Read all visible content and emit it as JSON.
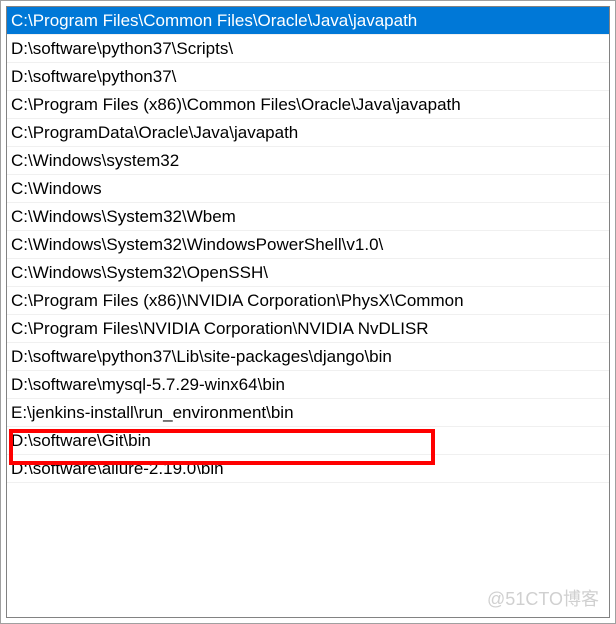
{
  "path_list": {
    "items": [
      {
        "path": "C:\\Program Files\\Common Files\\Oracle\\Java\\javapath",
        "selected": true
      },
      {
        "path": "D:\\software\\python37\\Scripts\\",
        "selected": false
      },
      {
        "path": "D:\\software\\python37\\",
        "selected": false
      },
      {
        "path": "C:\\Program Files (x86)\\Common Files\\Oracle\\Java\\javapath",
        "selected": false
      },
      {
        "path": "C:\\ProgramData\\Oracle\\Java\\javapath",
        "selected": false
      },
      {
        "path": "C:\\Windows\\system32",
        "selected": false
      },
      {
        "path": "C:\\Windows",
        "selected": false
      },
      {
        "path": "C:\\Windows\\System32\\Wbem",
        "selected": false
      },
      {
        "path": "C:\\Windows\\System32\\WindowsPowerShell\\v1.0\\",
        "selected": false
      },
      {
        "path": "C:\\Windows\\System32\\OpenSSH\\",
        "selected": false
      },
      {
        "path": "C:\\Program Files (x86)\\NVIDIA Corporation\\PhysX\\Common",
        "selected": false
      },
      {
        "path": "C:\\Program Files\\NVIDIA Corporation\\NVIDIA NvDLISR",
        "selected": false
      },
      {
        "path": "D:\\software\\python37\\Lib\\site-packages\\django\\bin",
        "selected": false
      },
      {
        "path": "D:\\software\\mysql-5.7.29-winx64\\bin",
        "selected": false
      },
      {
        "path": "E:\\jenkins-install\\run_environment\\bin",
        "selected": false,
        "highlighted": true
      },
      {
        "path": "D:\\software\\Git\\bin",
        "selected": false
      },
      {
        "path": "D:\\software\\allure-2.19.0\\bin",
        "selected": false
      }
    ]
  },
  "watermark": "@51CTO博客"
}
